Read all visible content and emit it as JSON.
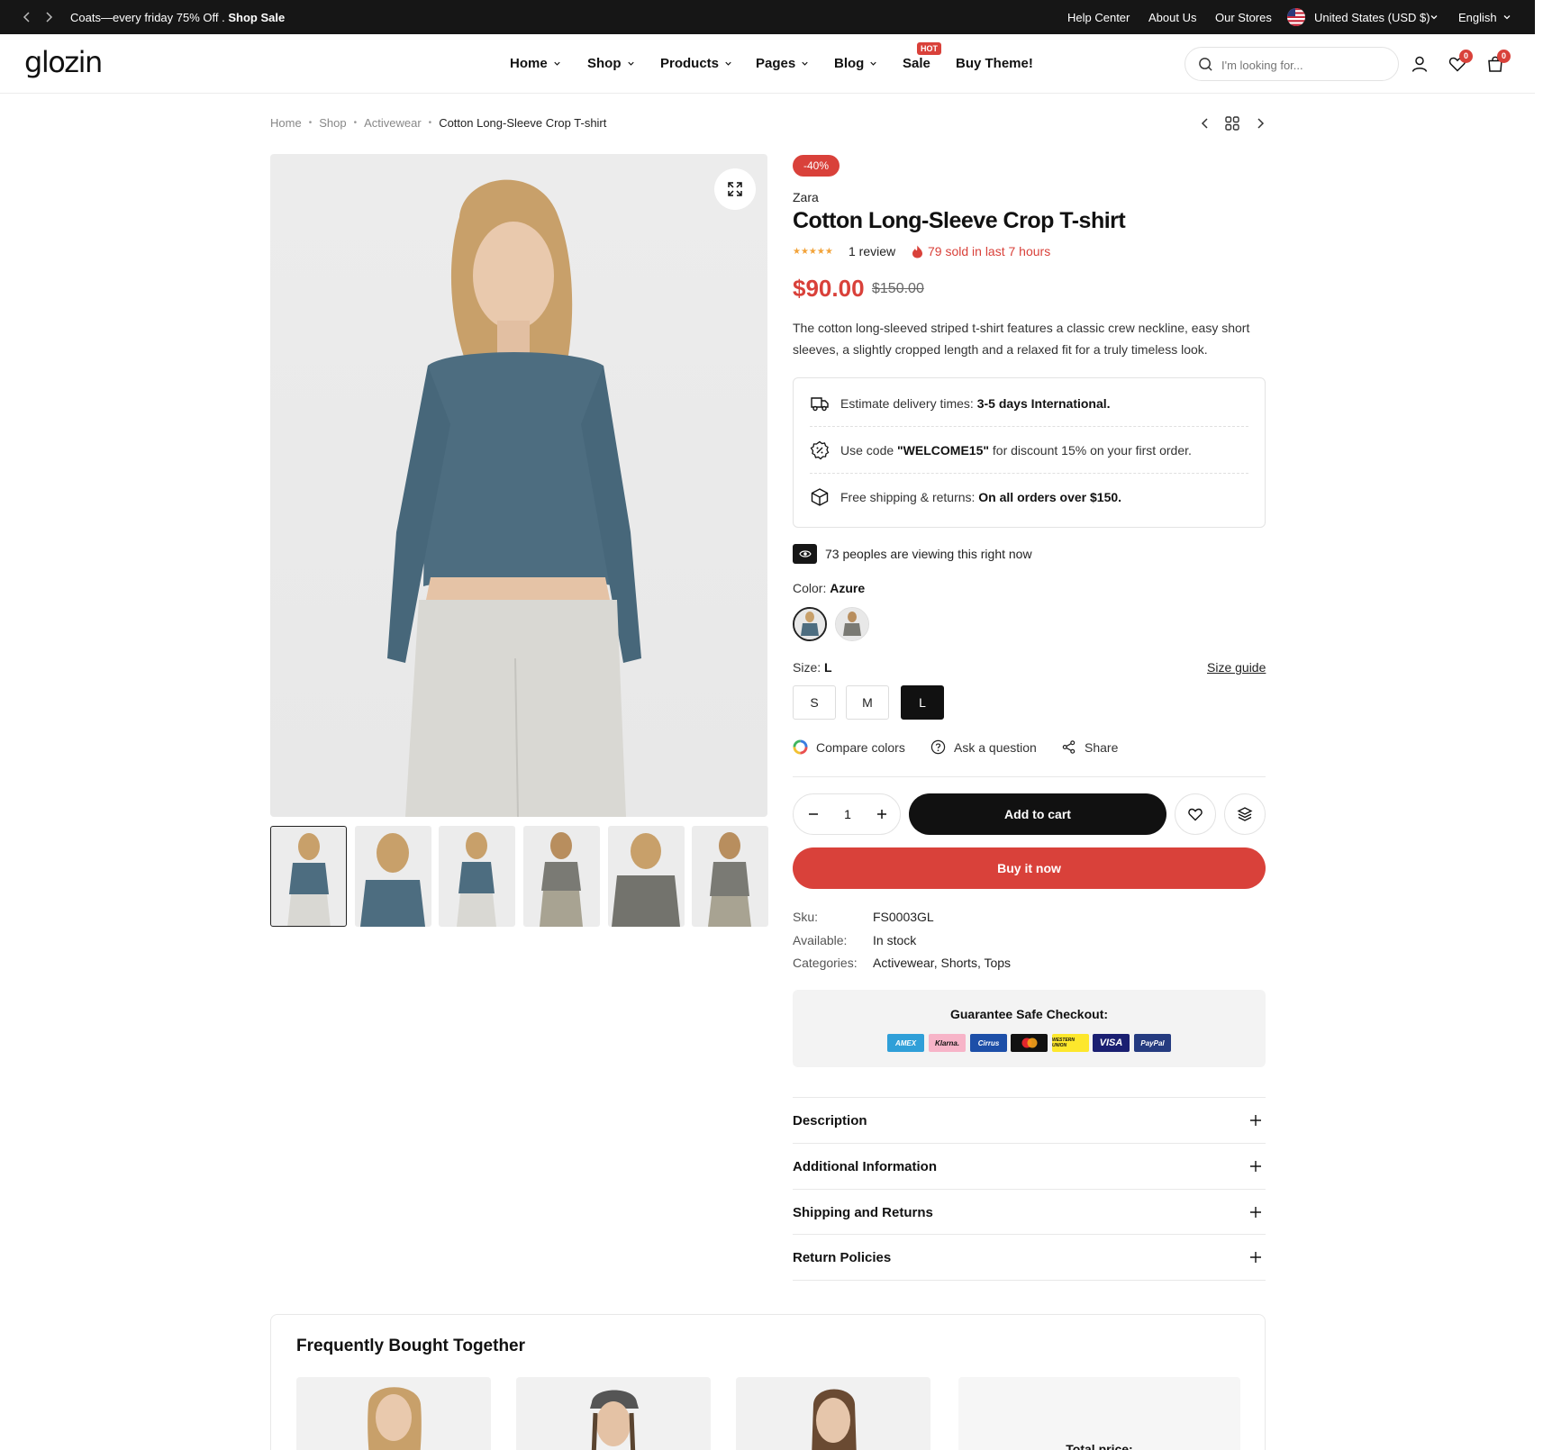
{
  "topbar": {
    "announcement_text": "Coats—every friday 75% Off .",
    "announcement_link": "Shop Sale",
    "links": [
      "Help Center",
      "About Us",
      "Our Stores"
    ],
    "currency": "United States (USD $)",
    "language": "English"
  },
  "header": {
    "logo": "glozin",
    "nav": [
      "Home",
      "Shop",
      "Products",
      "Pages",
      "Blog",
      "Sale",
      "Buy Theme!"
    ],
    "hot_badge": "HOT",
    "search_placeholder": "I'm looking for...",
    "wishlist_count": "0",
    "cart_count": "0"
  },
  "breadcrumb": {
    "items": [
      "Home",
      "Shop",
      "Activewear"
    ],
    "current": "Cotton Long-Sleeve Crop T-shirt"
  },
  "product": {
    "discount": "-40%",
    "brand": "Zara",
    "title": "Cotton Long-Sleeve Crop T-shirt",
    "stars": "★★★★★",
    "rating": 5,
    "reviews": "1 review",
    "sold": "79 sold in last 7 hours",
    "price": "$90.00",
    "old_price": "$150.00",
    "description": "The cotton long-sleeved striped t-shirt features a classic crew neckline, easy short sleeves, a slightly cropped length and a relaxed fit for a truly timeless look."
  },
  "info_box": {
    "delivery_label": "Estimate delivery times:",
    "delivery_value": "3-5 days International.",
    "code_prefix": "Use code",
    "code_value": "\"WELCOME15\"",
    "code_suffix": "for discount 15% on your first order.",
    "shipping_label": "Free shipping & returns:",
    "shipping_value": "On all orders over $150."
  },
  "viewing": "73 peoples are viewing this right now",
  "color": {
    "label": "Color:",
    "selected": "Azure",
    "swatch_colors": [
      "#4d6d80",
      "#7a7a74"
    ]
  },
  "size": {
    "label": "Size:",
    "selected": "L",
    "options": [
      "S",
      "M",
      "L"
    ],
    "guide": "Size guide"
  },
  "actions": {
    "compare": "Compare colors",
    "ask": "Ask a question",
    "share": "Share"
  },
  "cart": {
    "quantity": "1",
    "add_to_cart": "Add to cart",
    "buy_now": "Buy it now"
  },
  "meta": {
    "sku_label": "Sku:",
    "sku_value": "FS0003GL",
    "available_label": "Available:",
    "available_value": "In stock",
    "categories_label": "Categories:",
    "categories_value": "Activewear, Shorts, Tops"
  },
  "checkout": {
    "title": "Guarantee Safe Checkout:",
    "methods": [
      "AMEX",
      "Klarna.",
      "Cirrus",
      "Maestro",
      "WESTERN UNION",
      "VISA",
      "PayPal"
    ]
  },
  "accordion": [
    "Description",
    "Additional Information",
    "Shipping and Returns",
    "Return Policies"
  ],
  "fbt": {
    "title": "Frequently Bought Together",
    "total_label": "Total price:"
  },
  "colors": {
    "accent_red": "#d9413a",
    "dark": "#161616"
  }
}
